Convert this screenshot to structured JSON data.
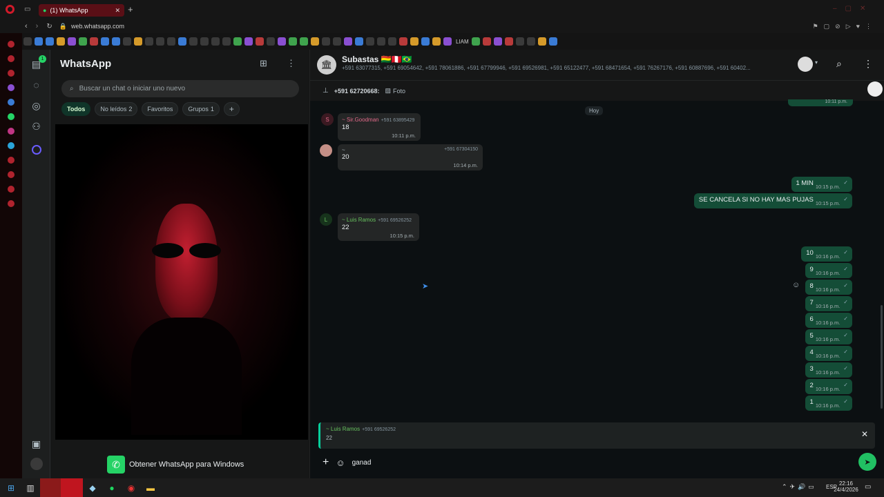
{
  "browser": {
    "tab_title": "(1) WhatsApp",
    "url": "web.whatsapp.com",
    "bookmark_label": "LIAM"
  },
  "sidebar": {
    "chats_badge": "1"
  },
  "panel": {
    "title": "WhatsApp",
    "search_placeholder": "Buscar un chat o iniciar uno nuevo",
    "filters": [
      {
        "label": "Todos",
        "count": ""
      },
      {
        "label": "No leídos",
        "count": "2"
      },
      {
        "label": "Favoritos",
        "count": ""
      },
      {
        "label": "Grupos",
        "count": "1"
      }
    ],
    "get_app_label": "Obtener WhatsApp para Windows"
  },
  "chat": {
    "group_name": "Subastas 🇧🇴🇵🇪🇧🇷",
    "members": "+591 63077315, +591 69054642, +591 78061886, +591 67799946, +591 69526981, +591 65122477, +591 68471654, +591 76267176, +591 60887696, +591 60402...",
    "pinned_sender": "+591 62720668:",
    "pinned_text": "Foto",
    "day_label": "Hoy",
    "incoming": [
      {
        "avatar": "S",
        "sender": "~ Sir.Goodman",
        "phone": "+591 63895429",
        "text": "18",
        "time": "10:11 p.m."
      },
      {
        "avatar": "",
        "sender": "~",
        "phone": "+591 67304150",
        "text": "20",
        "time": "10:14 p.m."
      },
      {
        "avatar": "L",
        "sender": "~ Luis Ramos",
        "phone": "+591 69526252",
        "text": "22",
        "time": "10:15 p.m."
      }
    ],
    "outgoing": [
      {
        "text": "1 MIN",
        "time": "10:15 p.m."
      },
      {
        "text": "SE CANCELA SI NO HAY MAS PUJAS",
        "time": "10:15 p.m."
      },
      {
        "text": "10",
        "time": "10:16 p.m."
      },
      {
        "text": "9",
        "time": "10:16 p.m."
      },
      {
        "text": "8",
        "time": "10:16 p.m."
      },
      {
        "text": "7",
        "time": "10:16 p.m."
      },
      {
        "text": "6",
        "time": "10:16 p.m."
      },
      {
        "text": "5",
        "time": "10:16 p.m."
      },
      {
        "text": "4",
        "time": "10:16 p.m."
      },
      {
        "text": "3",
        "time": "10:16 p.m."
      },
      {
        "text": "2",
        "time": "10:16 p.m."
      },
      {
        "text": "1",
        "time": "10:16 p.m."
      }
    ],
    "top_time": "10:11 p.m.",
    "reply": {
      "sender": "~ Luis Ramos",
      "phone": "+591 69526252",
      "text": "22"
    },
    "composer_text": "ganad"
  },
  "taskbar": {
    "language": "ESP",
    "time": "22:16",
    "date": "24/4/2026"
  },
  "colors": {
    "accent": "#21c063",
    "outgoing_bubble": "#144d37",
    "opera_red": "#b0232e"
  }
}
